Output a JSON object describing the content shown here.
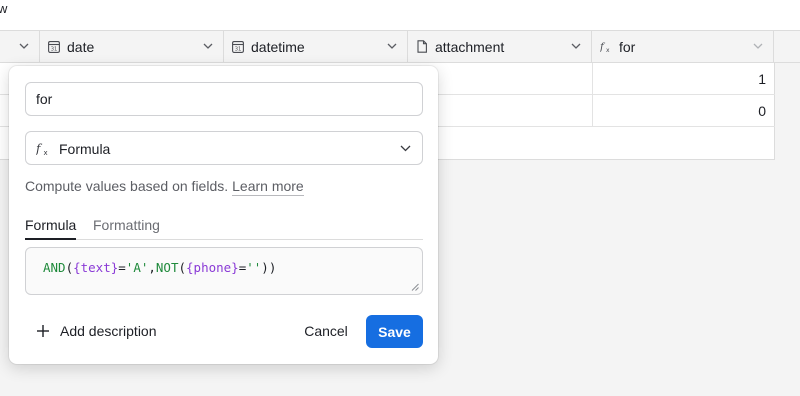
{
  "topbar": {
    "fragment_text": "w"
  },
  "columns": [
    {
      "name": "",
      "icon": "chevron-down-icon"
    },
    {
      "name": "date",
      "icon": "calendar-icon"
    },
    {
      "name": "datetime",
      "icon": "calendar-icon"
    },
    {
      "name": "attachment",
      "icon": "file-icon"
    },
    {
      "name": "for",
      "icon": "formula-icon"
    }
  ],
  "rows": [
    {
      "for": "1"
    },
    {
      "for": "0"
    }
  ],
  "field_editor": {
    "name_value": "for",
    "field_type": {
      "label": "Formula",
      "icon": "formula-icon"
    },
    "description": "Compute values based on fields.",
    "learn_more": "Learn more",
    "tabs": [
      {
        "label": "Formula",
        "active": true
      },
      {
        "label": "Formatting",
        "active": false
      }
    ],
    "formula_tokens": {
      "and": "AND",
      "p1": "(",
      "field_text": "{text}",
      "eq1": "=",
      "str_a": "'A'",
      "comma": ",",
      "not": "NOT",
      "p2": "(",
      "field_phone": "{phone}",
      "eq2": "=",
      "str_empty": "''",
      "close": "))"
    },
    "add_description": "Add description",
    "cancel_label": "Cancel",
    "save_label": "Save"
  },
  "colors": {
    "primary_button": "#166ee1",
    "function_token": "#1f8a3b",
    "field_token": "#8a3ad6"
  }
}
